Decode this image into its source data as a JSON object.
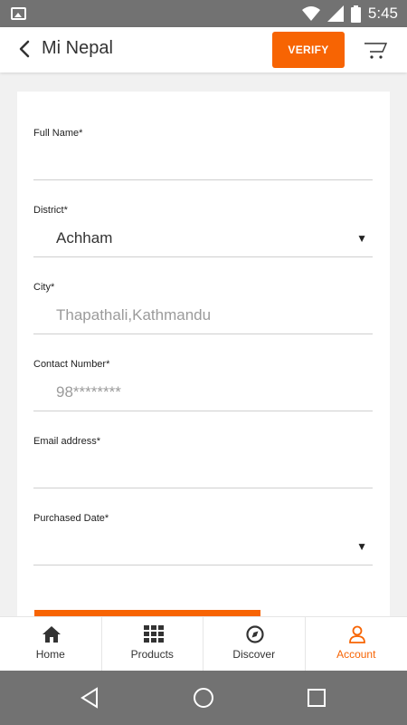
{
  "status_bar": {
    "time": "5:45"
  },
  "header": {
    "title": "Mi Nepal",
    "verify_label": "VERIFY"
  },
  "form": {
    "full_name": {
      "label": "Full Name*",
      "value": ""
    },
    "district": {
      "label": "District*",
      "value": "Achham"
    },
    "city": {
      "label": "City*",
      "placeholder": "Thapathali,Kathmandu"
    },
    "contact": {
      "label": "Contact Number*",
      "placeholder": "98********"
    },
    "email": {
      "label": "Email address*",
      "value": ""
    },
    "purchased_date": {
      "label": "Purchased Date*",
      "value": ""
    }
  },
  "tabs": [
    {
      "label": "Home",
      "icon": "home-icon"
    },
    {
      "label": "Products",
      "icon": "grid-icon"
    },
    {
      "label": "Discover",
      "icon": "compass-icon"
    },
    {
      "label": "Account",
      "icon": "user-icon",
      "active": true
    }
  ],
  "colors": {
    "accent": "#f76403",
    "system_bar": "#727272"
  }
}
